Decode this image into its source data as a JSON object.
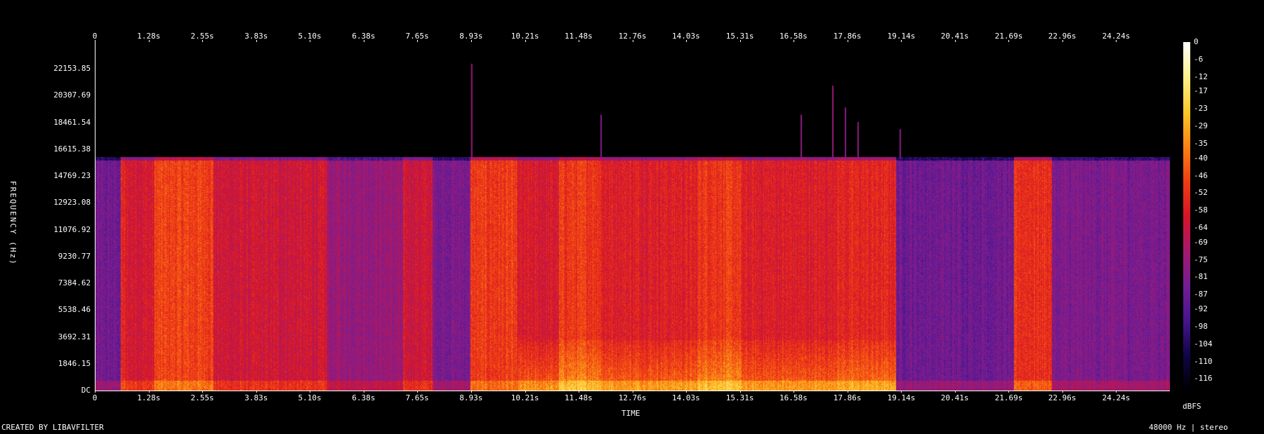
{
  "chart_data": {
    "type": "heatmap",
    "xlabel": "TIME",
    "ylabel": "FREQUENCY (Hz)",
    "x_ticks": [
      "0",
      "1.28s",
      "2.55s",
      "3.83s",
      "5.10s",
      "6.38s",
      "7.65s",
      "8.93s",
      "10.21s",
      "11.48s",
      "12.76s",
      "14.03s",
      "15.31s",
      "16.58s",
      "17.86s",
      "19.14s",
      "20.41s",
      "21.69s",
      "22.96s",
      "24.24s"
    ],
    "x_tick_values": [
      0,
      1.28,
      2.55,
      3.83,
      5.1,
      6.38,
      7.65,
      8.93,
      10.21,
      11.48,
      12.76,
      14.03,
      15.31,
      16.58,
      17.86,
      19.14,
      20.41,
      21.69,
      22.96,
      24.24
    ],
    "xlim": [
      0,
      25.5
    ],
    "y_ticks": [
      "DC",
      "1846.15",
      "3692.31",
      "5538.46",
      "7384.62",
      "9230.77",
      "11076.92",
      "12923.08",
      "14769.23",
      "16615.38",
      "18461.54",
      "20307.69",
      "22153.85"
    ],
    "y_tick_values": [
      0,
      1846.15,
      3692.31,
      5538.46,
      7384.62,
      9230.77,
      11076.92,
      12923.08,
      14769.23,
      16615.38,
      18461.54,
      20307.69,
      22153.85
    ],
    "ylim": [
      0,
      24000
    ],
    "colorbar_unit": "dBFS",
    "colorbar_ticks": [
      "0",
      "-6",
      "-12",
      "-17",
      "-23",
      "-29",
      "-35",
      "-40",
      "-46",
      "-52",
      "-58",
      "-64",
      "-69",
      "-75",
      "-81",
      "-87",
      "-92",
      "-98",
      "-104",
      "-110",
      "-116"
    ],
    "colorbar_tick_values": [
      0,
      -6,
      -12,
      -17,
      -23,
      -29,
      -35,
      -40,
      -46,
      -52,
      -58,
      -64,
      -69,
      -75,
      -81,
      -87,
      -92,
      -98,
      -104,
      -110,
      -116
    ],
    "cutoff_frequency_hz": 16000,
    "segments": [
      {
        "t0": 0.0,
        "t1": 0.6,
        "level": -85
      },
      {
        "t0": 0.6,
        "t1": 0.7,
        "level": -55
      },
      {
        "t0": 0.7,
        "t1": 1.4,
        "level": -60
      },
      {
        "t0": 1.4,
        "t1": 2.8,
        "level": -48
      },
      {
        "t0": 2.8,
        "t1": 5.5,
        "level": -62
      },
      {
        "t0": 5.5,
        "t1": 7.3,
        "level": -75
      },
      {
        "t0": 7.3,
        "t1": 8.0,
        "level": -62
      },
      {
        "t0": 8.0,
        "t1": 8.9,
        "level": -82
      },
      {
        "t0": 8.9,
        "t1": 10.0,
        "level": -50
      },
      {
        "t0": 10.0,
        "t1": 11.0,
        "level": -60
      },
      {
        "t0": 11.0,
        "t1": 12.0,
        "level": -50
      },
      {
        "t0": 12.0,
        "t1": 14.3,
        "level": -57
      },
      {
        "t0": 14.3,
        "t1": 15.3,
        "level": -50
      },
      {
        "t0": 15.3,
        "t1": 17.5,
        "level": -58
      },
      {
        "t0": 17.5,
        "t1": 19.0,
        "level": -55
      },
      {
        "t0": 19.0,
        "t1": 21.8,
        "level": -85
      },
      {
        "t0": 21.8,
        "t1": 22.7,
        "level": -52
      },
      {
        "t0": 22.7,
        "t1": 25.5,
        "level": -82
      }
    ],
    "spikes": [
      {
        "t": 8.93,
        "f_top": 22500,
        "level": -75
      },
      {
        "t": 12.0,
        "f_top": 19000,
        "level": -80
      },
      {
        "t": 16.75,
        "f_top": 19000,
        "level": -78
      },
      {
        "t": 17.5,
        "f_top": 21000,
        "level": -75
      },
      {
        "t": 17.8,
        "f_top": 19500,
        "level": -80
      },
      {
        "t": 18.1,
        "f_top": 18500,
        "level": -78
      },
      {
        "t": 19.1,
        "f_top": 18000,
        "level": -80
      }
    ]
  },
  "footer": {
    "left": "CREATED BY LIBAVFILTER",
    "right": "48000 Hz | stereo"
  }
}
